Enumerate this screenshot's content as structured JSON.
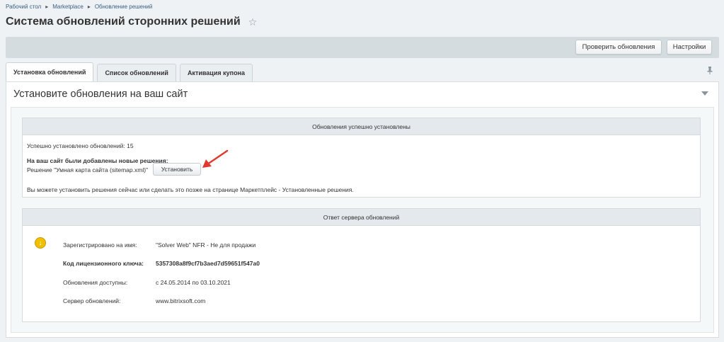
{
  "breadcrumb": {
    "items": [
      "Рабочий стол",
      "Marketplace",
      "Обновление решений"
    ],
    "separator": "▸"
  },
  "page": {
    "title": "Система обновлений сторонних решений",
    "star_icon": "☆"
  },
  "toolbar": {
    "check_updates_label": "Проверить обновления",
    "settings_label": "Настройки"
  },
  "tabs": [
    {
      "label": "Установка обновлений",
      "active": true
    },
    {
      "label": "Список обновлений",
      "active": false
    },
    {
      "label": "Активация купона",
      "active": false
    }
  ],
  "pin_icon": "pin-icon",
  "panel": {
    "title": "Установите обновления на ваш сайт"
  },
  "success_box": {
    "header": "Обновления успешно установлены",
    "installed_count": "Успешно установлено обновлений: 15",
    "new_solutions_label": "На ваш сайт были добавлены новые решения:",
    "solution_text": "Решение \"Умная карта сайта (sitemap.xml)\"",
    "install_button": "Установить",
    "note": "Вы можете установить решения сейчас или сделать это позже на странице Маркетплейс - Установленные решения."
  },
  "server_box": {
    "header": "Ответ сервера обновлений",
    "rows": [
      {
        "label": "Зарегистрировано на имя:",
        "value": "\"Solver Web\" NFR - Не для продажи",
        "bold": false
      },
      {
        "label": "Код лицензионного ключа:",
        "value": "5357308a8f9cf7b3aed7d59651f547a0",
        "bold": true
      },
      {
        "label": "Обновления доступны:",
        "value": "с 24.05.2014 по 03.10.2021",
        "bold": false
      },
      {
        "label": "Сервер обновлений:",
        "value": "www.bitrixsoft.com",
        "bold": false
      }
    ]
  },
  "colors": {
    "accent_arrow": "#e03a2e",
    "warning": "#f0c000"
  }
}
